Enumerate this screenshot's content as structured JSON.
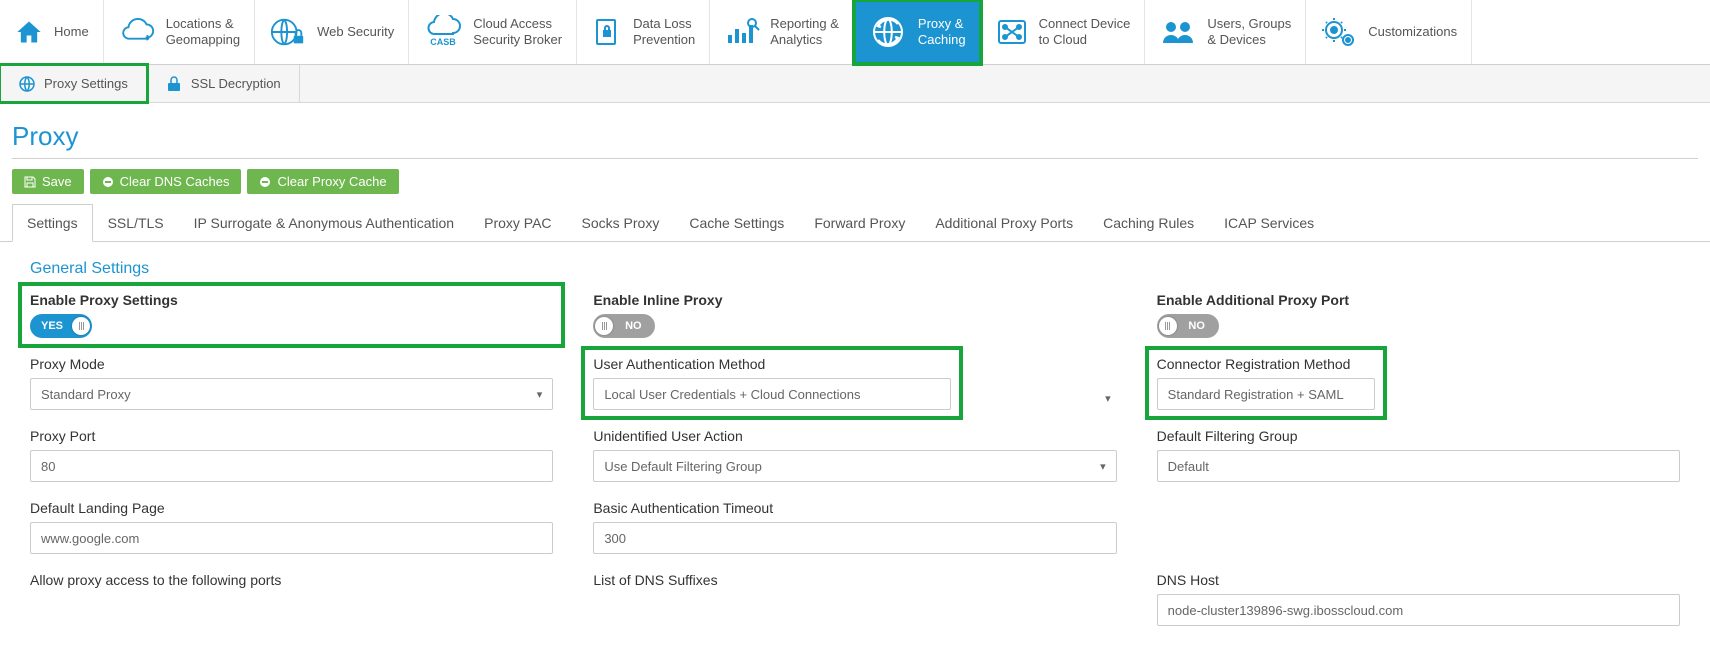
{
  "topnav": [
    {
      "label1": "Home",
      "label2": ""
    },
    {
      "label1": "Locations &",
      "label2": "Geomapping"
    },
    {
      "label1": "Web Security",
      "label2": ""
    },
    {
      "label1": "Cloud Access",
      "label2": "Security Broker"
    },
    {
      "label1": "Data Loss",
      "label2": "Prevention"
    },
    {
      "label1": "Reporting &",
      "label2": "Analytics"
    },
    {
      "label1": "Proxy &",
      "label2": "Caching"
    },
    {
      "label1": "Connect Device",
      "label2": "to Cloud"
    },
    {
      "label1": "Users, Groups",
      "label2": "& Devices"
    },
    {
      "label1": "Customizations",
      "label2": ""
    }
  ],
  "subnav": {
    "proxy_settings": "Proxy Settings",
    "ssl_decryption": "SSL Decryption"
  },
  "page_title": "Proxy",
  "actions": {
    "save": "Save",
    "clear_dns": "Clear DNS Caches",
    "clear_proxy": "Clear Proxy Cache"
  },
  "tabs": [
    "Settings",
    "SSL/TLS",
    "IP Surrogate & Anonymous Authentication",
    "Proxy PAC",
    "Socks Proxy",
    "Cache Settings",
    "Forward Proxy",
    "Additional Proxy Ports",
    "Caching Rules",
    "ICAP Services"
  ],
  "section_heading": "General Settings",
  "fields": {
    "enable_proxy_settings": {
      "label": "Enable Proxy Settings",
      "value": "YES"
    },
    "enable_inline_proxy": {
      "label": "Enable Inline Proxy",
      "value": "NO"
    },
    "enable_additional_proxy_port": {
      "label": "Enable Additional Proxy Port",
      "value": "NO"
    },
    "proxy_mode": {
      "label": "Proxy Mode",
      "value": "Standard Proxy"
    },
    "user_auth_method": {
      "label": "User Authentication Method",
      "value": "Local User Credentials + Cloud Connections"
    },
    "connector_reg_method": {
      "label": "Connector Registration Method",
      "value": "Standard Registration + SAML"
    },
    "proxy_port": {
      "label": "Proxy Port",
      "value": "80"
    },
    "unidentified_user_action": {
      "label": "Unidentified User Action",
      "value": "Use Default Filtering Group"
    },
    "default_filtering_group": {
      "label": "Default Filtering Group",
      "value": "Default"
    },
    "default_landing_page": {
      "label": "Default Landing Page",
      "value": "www.google.com"
    },
    "basic_auth_timeout": {
      "label": "Basic Authentication Timeout",
      "value": "300"
    },
    "allow_proxy_ports": {
      "label": "Allow proxy access to the following ports"
    },
    "list_dns_suffixes": {
      "label": "List of DNS Suffixes"
    },
    "dns_host": {
      "label": "DNS Host",
      "value": "node-cluster139896-swg.ibosscloud.com"
    }
  }
}
